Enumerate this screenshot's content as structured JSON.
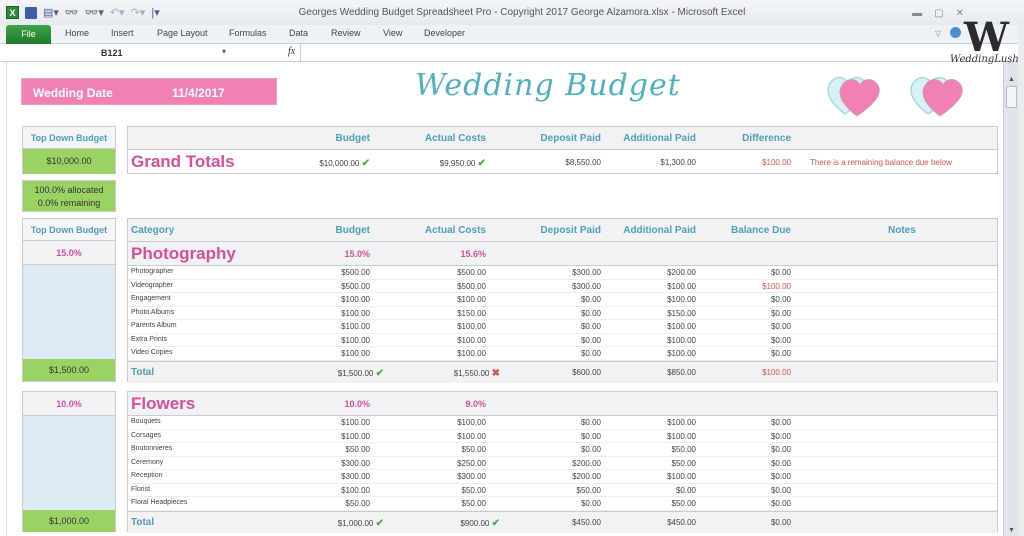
{
  "window": {
    "title": "Georges Wedding Budget Spreadsheet Pro - Copyright 2017 George Alzamora.xlsx  -  Microsoft Excel",
    "qat_icons": [
      "excel-icon",
      "save-icon",
      "print-icon",
      "find-icon",
      "replace-icon",
      "undo-icon",
      "redo-icon",
      "customize-qat-icon"
    ]
  },
  "ribbon": {
    "tabs": [
      "File",
      "Home",
      "Insert",
      "Page Layout",
      "Formulas",
      "Data",
      "Review",
      "View",
      "Developer"
    ]
  },
  "formula_bar": {
    "name_box": "B121",
    "fx_label": "fx",
    "formula": ""
  },
  "header": {
    "wedding_date_label": "Wedding Date",
    "wedding_date_value": "11/4/2017",
    "title": "Wedding Budget"
  },
  "colors": {
    "pink": "#f280b3",
    "teal": "#4fb1bd",
    "green": "#9bd264",
    "magenta_text": "#d54f9a",
    "light_blue": "#dcebf5"
  },
  "summary": {
    "top_down_label": "Top Down Budget",
    "top_down_value": "$10,000.00",
    "allocated": "100.0%  allocated",
    "remaining": "0.0%  remaining"
  },
  "grand_totals": {
    "headers": [
      "Budget",
      "Actual Costs",
      "Deposit Paid",
      "Additional Paid",
      "Difference"
    ],
    "label": "Grand Totals",
    "budget": "$10,000.00",
    "actual": "$9,950.00",
    "deposit": "$8,550.00",
    "additional": "$1,300.00",
    "difference": "$100.00",
    "message": "There is a remaining balance due below"
  },
  "columns": {
    "category": "Category",
    "budget": "Budget",
    "actual": "Actual Costs",
    "deposit": "Deposit Paid",
    "additional": "Additional Paid",
    "balance": "Balance Due",
    "notes": "Notes",
    "total": "Total"
  },
  "categories": [
    {
      "name": "Photography",
      "side_pct": "15.0%",
      "side_value": "$1,500.00",
      "budget_pct": "15.0%",
      "actual_pct": "15.6%",
      "items": [
        {
          "name": "Photographer",
          "budget": "$500.00",
          "actual": "$500.00",
          "deposit": "$300.00",
          "additional": "$200.00",
          "balance": "$0.00"
        },
        {
          "name": "Videographer",
          "budget": "$500.00",
          "actual": "$500.00",
          "deposit": "$300.00",
          "additional": "$100.00",
          "balance": "$100.00"
        },
        {
          "name": "Engagement",
          "budget": "$100.00",
          "actual": "$100.00",
          "deposit": "$0.00",
          "additional": "$100.00",
          "balance": "$0.00"
        },
        {
          "name": "Photo Albums",
          "budget": "$100.00",
          "actual": "$150.00",
          "deposit": "$0.00",
          "additional": "$150.00",
          "balance": "$0.00"
        },
        {
          "name": "Parents Album",
          "budget": "$100.00",
          "actual": "$100.00",
          "deposit": "$0.00",
          "additional": "$100.00",
          "balance": "$0.00"
        },
        {
          "name": "Extra Prints",
          "budget": "$100.00",
          "actual": "$100.00",
          "deposit": "$0.00",
          "additional": "$100.00",
          "balance": "$0.00"
        },
        {
          "name": "Video Copies",
          "budget": "$100.00",
          "actual": "$100.00",
          "deposit": "$0.00",
          "additional": "$100.00",
          "balance": "$0.00"
        }
      ],
      "total": {
        "budget": "$1,500.00",
        "budget_status": "check",
        "actual": "$1,550.00",
        "actual_status": "cross",
        "deposit": "$600.00",
        "additional": "$850.00",
        "balance": "$100.00"
      }
    },
    {
      "name": "Flowers",
      "side_pct": "10.0%",
      "side_value": "$1,000.00",
      "budget_pct": "10.0%",
      "actual_pct": "9.0%",
      "items": [
        {
          "name": "Bouquets",
          "budget": "$100.00",
          "actual": "$100.00",
          "deposit": "$0.00",
          "additional": "$100.00",
          "balance": "$0.00"
        },
        {
          "name": "Corsages",
          "budget": "$100.00",
          "actual": "$100.00",
          "deposit": "$0.00",
          "additional": "$100.00",
          "balance": "$0.00"
        },
        {
          "name": "Boutonnieres",
          "budget": "$50.00",
          "actual": "$50.00",
          "deposit": "$0.00",
          "additional": "$50.00",
          "balance": "$0.00"
        },
        {
          "name": "Ceremony",
          "budget": "$300.00",
          "actual": "$250.00",
          "deposit": "$200.00",
          "additional": "$50.00",
          "balance": "$0.00"
        },
        {
          "name": "Reception",
          "budget": "$300.00",
          "actual": "$300.00",
          "deposit": "$200.00",
          "additional": "$100.00",
          "balance": "$0.00"
        },
        {
          "name": "Florist",
          "budget": "$100.00",
          "actual": "$50.00",
          "deposit": "$50.00",
          "additional": "$0.00",
          "balance": "$0.00"
        },
        {
          "name": "Floral Headpieces",
          "budget": "$50.00",
          "actual": "$50.00",
          "deposit": "$0.00",
          "additional": "$50.00",
          "balance": "$0.00"
        }
      ],
      "total": {
        "budget": "$1,000.00",
        "budget_status": "check",
        "actual": "$900.00",
        "actual_status": "check",
        "deposit": "$450.00",
        "additional": "$450.00",
        "balance": "$0.00"
      }
    }
  ],
  "symbols": {
    "check": "✔",
    "cross": "✖"
  },
  "watermark": "WeddingLush"
}
